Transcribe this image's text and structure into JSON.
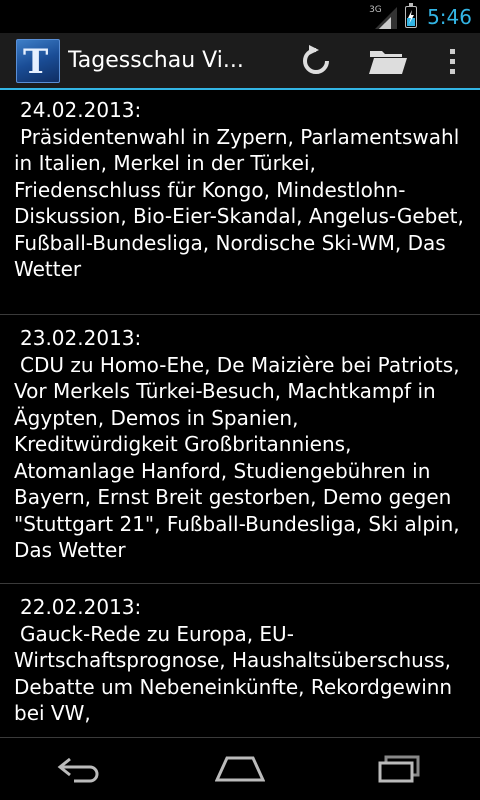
{
  "status_bar": {
    "network_label": "3G",
    "clock": "5:46"
  },
  "action_bar": {
    "title": "Tagesschau Vi...",
    "app_icon_letter": "T",
    "refresh_icon": "refresh-icon",
    "folder_icon": "folder-icon",
    "overflow_icon": "overflow-menu-icon"
  },
  "items": [
    {
      "date": "24.02.2013:",
      "text": "Präsidentenwahl in Zypern, Parlamentswahl in Italien, Merkel in der Türkei, Friedenschluss für Kongo, Mindestlohn-Diskussion, Bio-Eier-Skandal, Angelus-Gebet, Fußball-Bundesliga, Nordische Ski-WM, Das Wetter"
    },
    {
      "date": "23.02.2013:",
      "text": "CDU zu Homo-Ehe, De Maizière bei Patriots, Vor Merkels Türkei-Besuch, Machtkampf in Ägypten, Demos in Spanien, Kreditwürdigkeit Großbritanniens, Atomanlage Hanford, Studiengebühren in Bayern, Ernst Breit gestorben, Demo gegen \"Stuttgart 21\", Fußball-Bundesliga, Ski alpin, Das Wetter"
    },
    {
      "date": "22.02.2013:",
      "text": "Gauck-Rede zu Europa, EU-Wirtschaftsprognose, Haushaltsüberschuss, Debatte um Nebeneinkünfte, Rekordgewinn bei VW,"
    }
  ],
  "nav_bar": {
    "back_icon": "back-icon",
    "home_icon": "home-icon",
    "recents_icon": "recent-apps-icon"
  },
  "colors": {
    "accent": "#33b5e5",
    "background": "#000000",
    "action_bar": "#1c1c1c",
    "divider": "#3a3a3a"
  }
}
